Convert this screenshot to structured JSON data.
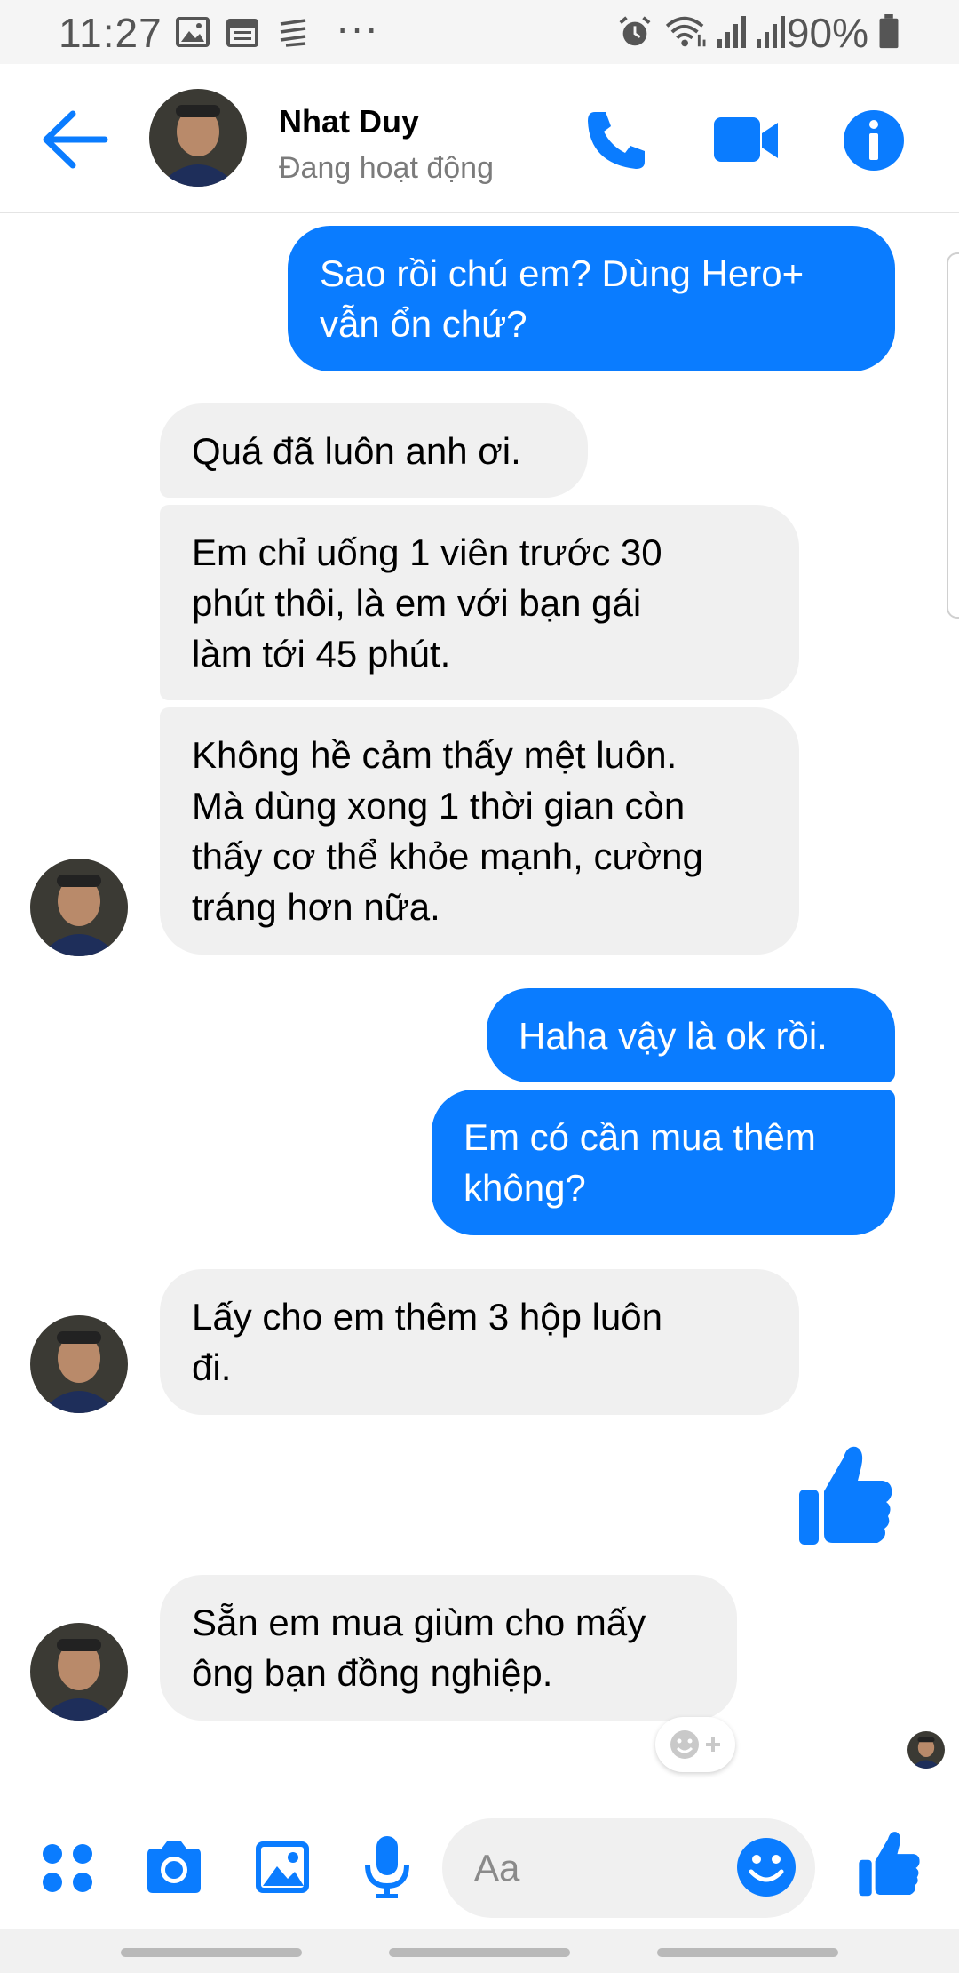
{
  "status_bar": {
    "time": "11:27",
    "dots": "···",
    "battery_percent": "90%",
    "icons": [
      "image-icon",
      "calendar-icon",
      "notes-icon",
      "alarm-icon",
      "wifi-icon",
      "signal-icon",
      "signal-icon",
      "battery-icon"
    ]
  },
  "header": {
    "contact_name": "Nhat Duy",
    "contact_status": "Đang hoạt động",
    "icons": [
      "back-arrow-icon",
      "phone-icon",
      "video-icon",
      "info-icon"
    ],
    "accent_color": "#0a7cff"
  },
  "messages": [
    {
      "id": 1,
      "direction": "outgoing",
      "lines": [
        "Sao rồi chú em? Dùng Hero+",
        "vẫn ổn chứ?"
      ]
    },
    {
      "id": 2,
      "direction": "incoming",
      "lines": [
        "Quá đã luôn anh ơi."
      ]
    },
    {
      "id": 3,
      "direction": "incoming",
      "lines": [
        "Em chỉ uống 1 viên trước 30",
        "phút thôi, là em với bạn gái",
        "làm tới 45 phút."
      ]
    },
    {
      "id": 4,
      "direction": "incoming",
      "lines": [
        "Không hề cảm thấy mệt luôn.",
        "Mà dùng xong 1 thời gian còn",
        "thấy cơ thể khỏe mạnh, cường",
        "tráng hơn nữa."
      ]
    },
    {
      "id": 5,
      "direction": "outgoing",
      "lines": [
        "Haha vậy là ok rồi."
      ]
    },
    {
      "id": 6,
      "direction": "outgoing",
      "lines": [
        "Em có cần mua thêm",
        "không?"
      ]
    },
    {
      "id": 7,
      "direction": "incoming",
      "lines": [
        "Lấy cho em thêm 3 hộp luôn",
        "đi."
      ]
    },
    {
      "id": 8,
      "direction": "outgoing",
      "type": "like-sticker",
      "icon": "thumbs-up-icon"
    },
    {
      "id": 9,
      "direction": "incoming",
      "lines": [
        "Sẵn em mua giùm cho mấy",
        "ông bạn đồng nghiệp."
      ]
    }
  ],
  "composer": {
    "placeholder": "Aa",
    "icons": [
      "apps-icon",
      "camera-icon",
      "gallery-icon",
      "microphone-icon",
      "emoji-icon",
      "thumbs-up-icon"
    ]
  },
  "colors": {
    "outgoing_bubble": "#0a7cff",
    "incoming_bubble": "#f0f0f0"
  }
}
